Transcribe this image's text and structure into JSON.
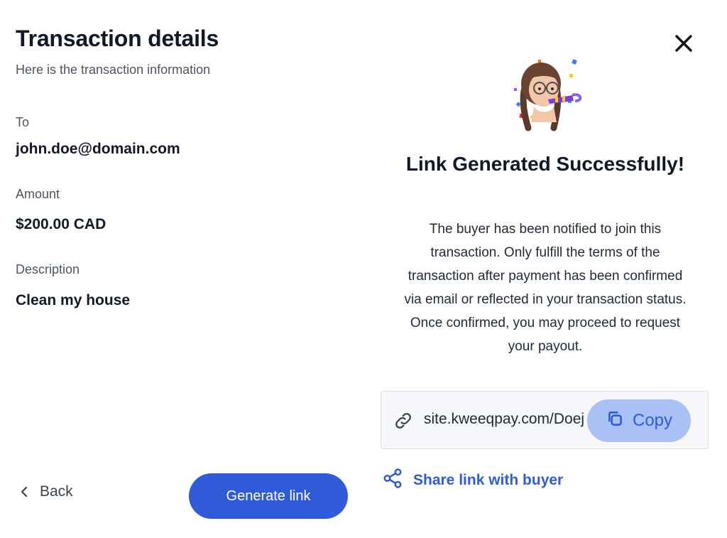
{
  "details": {
    "title": "Transaction details",
    "subtitle": "Here is the transaction information",
    "to_label": "To",
    "to_value": "john.doe@domain.com",
    "amount_label": "Amount",
    "amount_value": "$200.00 CAD",
    "description_label": "Description",
    "description_value": "Clean my house"
  },
  "footer": {
    "back_label": "Back",
    "generate_label": "Generate link"
  },
  "success": {
    "title": "Link Generated Successfully!",
    "message": "The buyer has been notified to join this transaction. Only fulfill the terms of the transaction after payment has been confirmed via email or reflected in your transaction status. Once confirmed, you may proceed to request your payout.",
    "link_url": "site.kweeqpay.com/Doej",
    "copy_label": "Copy",
    "share_label": "Share link with buyer"
  },
  "icons": {
    "close": "close-icon",
    "back": "chevron-left-icon",
    "link": "link-icon",
    "copy": "copy-icon",
    "share": "share-icon",
    "avatar": "party-avatar"
  },
  "colors": {
    "primary": "#2f5bd9",
    "copy_button_bg": "#a9c1f5",
    "link_box_bg": "#f5f7fb",
    "text_dark": "#111827",
    "text_muted": "#4b5563"
  }
}
